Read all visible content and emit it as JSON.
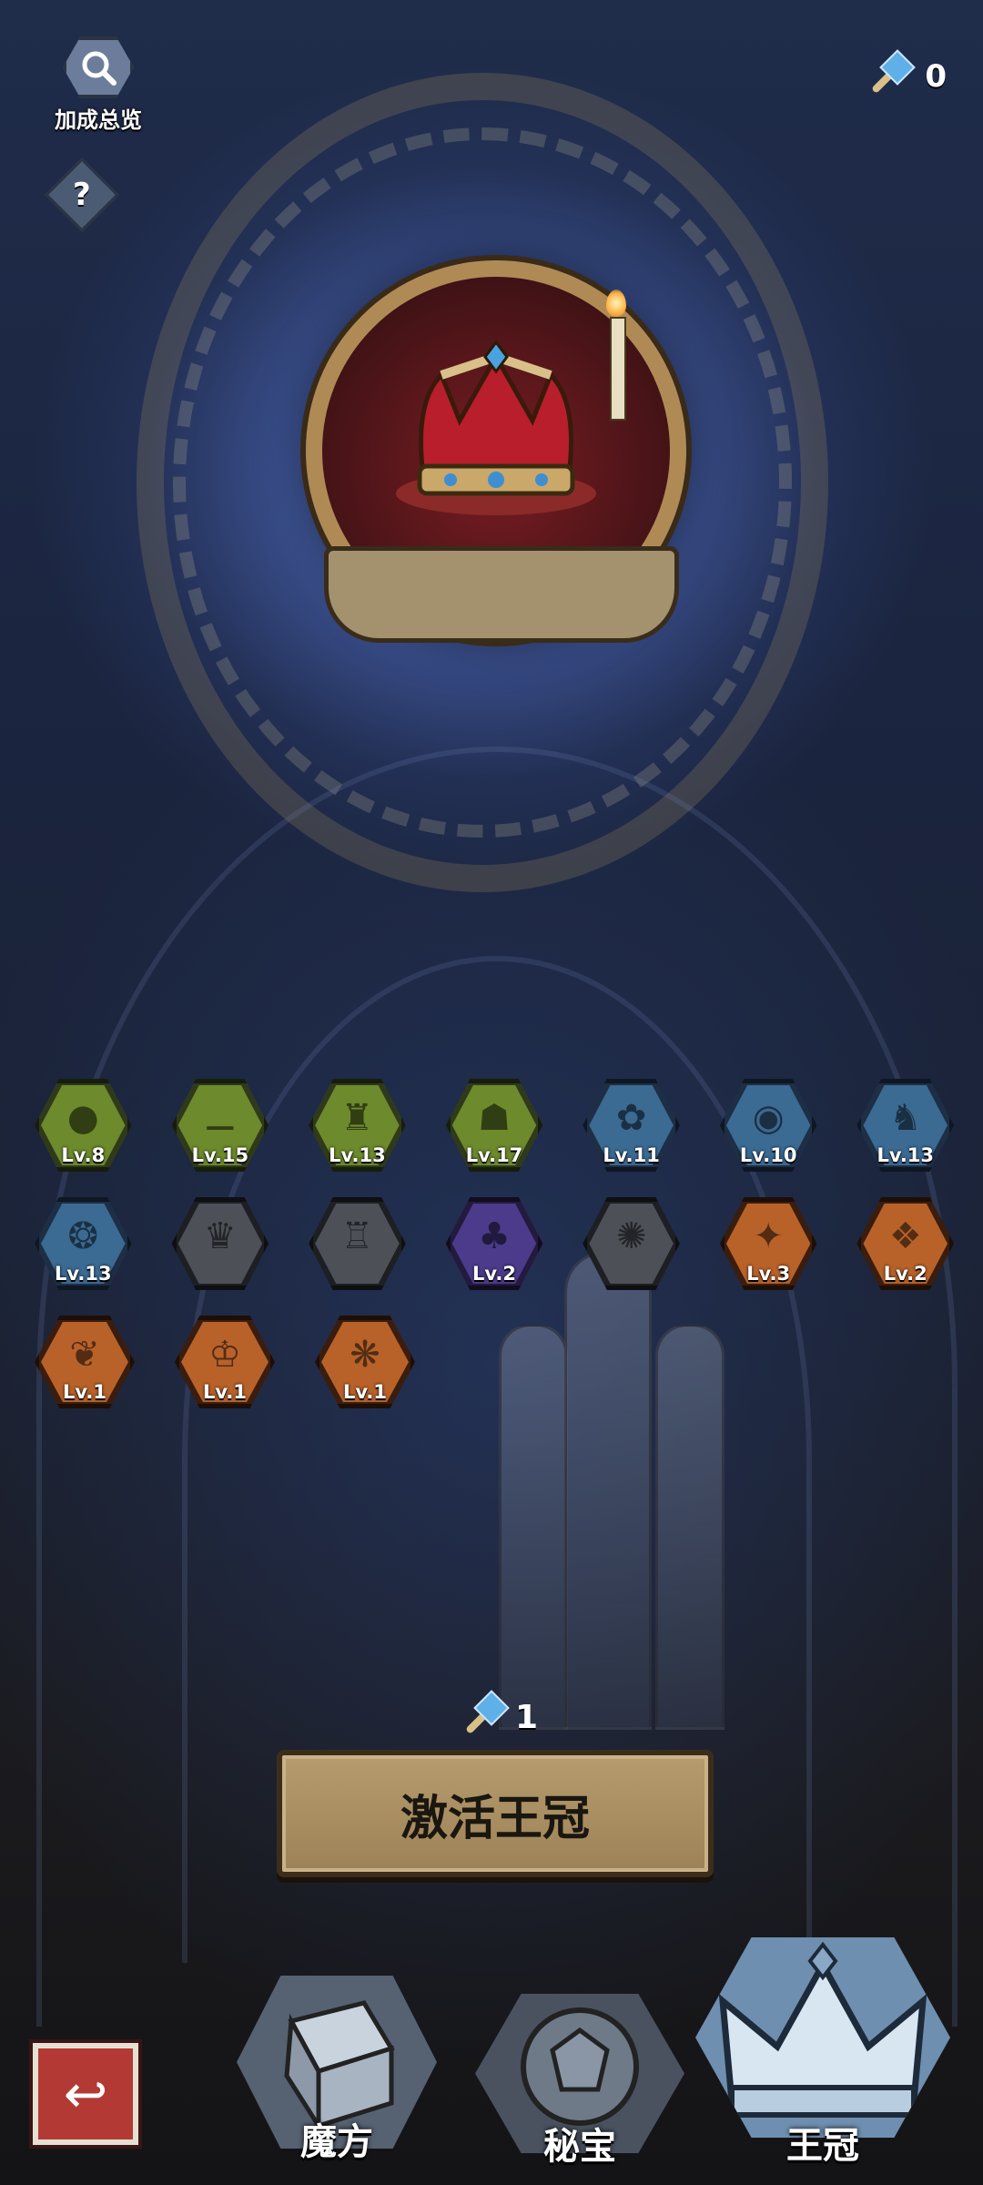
{
  "hud": {
    "bonus_overview_label": "加成总览",
    "help_label": "?",
    "currency_value": "0"
  },
  "badges": [
    {
      "level": "Lv.8",
      "color": "green",
      "icon": "silhouette-icon"
    },
    {
      "level": "Lv.15",
      "color": "green",
      "icon": "bone-icon"
    },
    {
      "level": "Lv.13",
      "color": "green",
      "icon": "top-hat-figure-icon"
    },
    {
      "level": "Lv.17",
      "color": "green",
      "icon": "ghost-icon"
    },
    {
      "level": "Lv.11",
      "color": "blue",
      "icon": "rabbit-icon"
    },
    {
      "level": "Lv.10",
      "color": "blue",
      "icon": "cyclops-icon"
    },
    {
      "level": "Lv.13",
      "color": "blue",
      "icon": "knight-helmet-icon"
    },
    {
      "level": "Lv.13",
      "color": "blue",
      "icon": "fish-icon"
    },
    {
      "level": "",
      "color": "gray",
      "icon": "devil-hat-icon"
    },
    {
      "level": "",
      "color": "gray",
      "icon": "magic-hat-icon"
    },
    {
      "level": "Lv.2",
      "color": "purple",
      "icon": "bunny-ears-icon"
    },
    {
      "level": "",
      "color": "gray",
      "icon": "octopus-icon"
    },
    {
      "level": "Lv.3",
      "color": "orange",
      "icon": "phoenix-icon"
    },
    {
      "level": "Lv.2",
      "color": "orange",
      "icon": "monster-icon"
    },
    {
      "level": "Lv.1",
      "color": "orange",
      "icon": "bat-icon"
    },
    {
      "level": "Lv.1",
      "color": "orange",
      "icon": "crown-icon"
    },
    {
      "level": "Lv.1",
      "color": "orange",
      "icon": "beast-head-icon"
    }
  ],
  "activate": {
    "cost": "1",
    "button_label": "激活王冠"
  },
  "tabs": [
    {
      "label": "魔方"
    },
    {
      "label": "秘宝"
    },
    {
      "label": "王冠"
    }
  ]
}
